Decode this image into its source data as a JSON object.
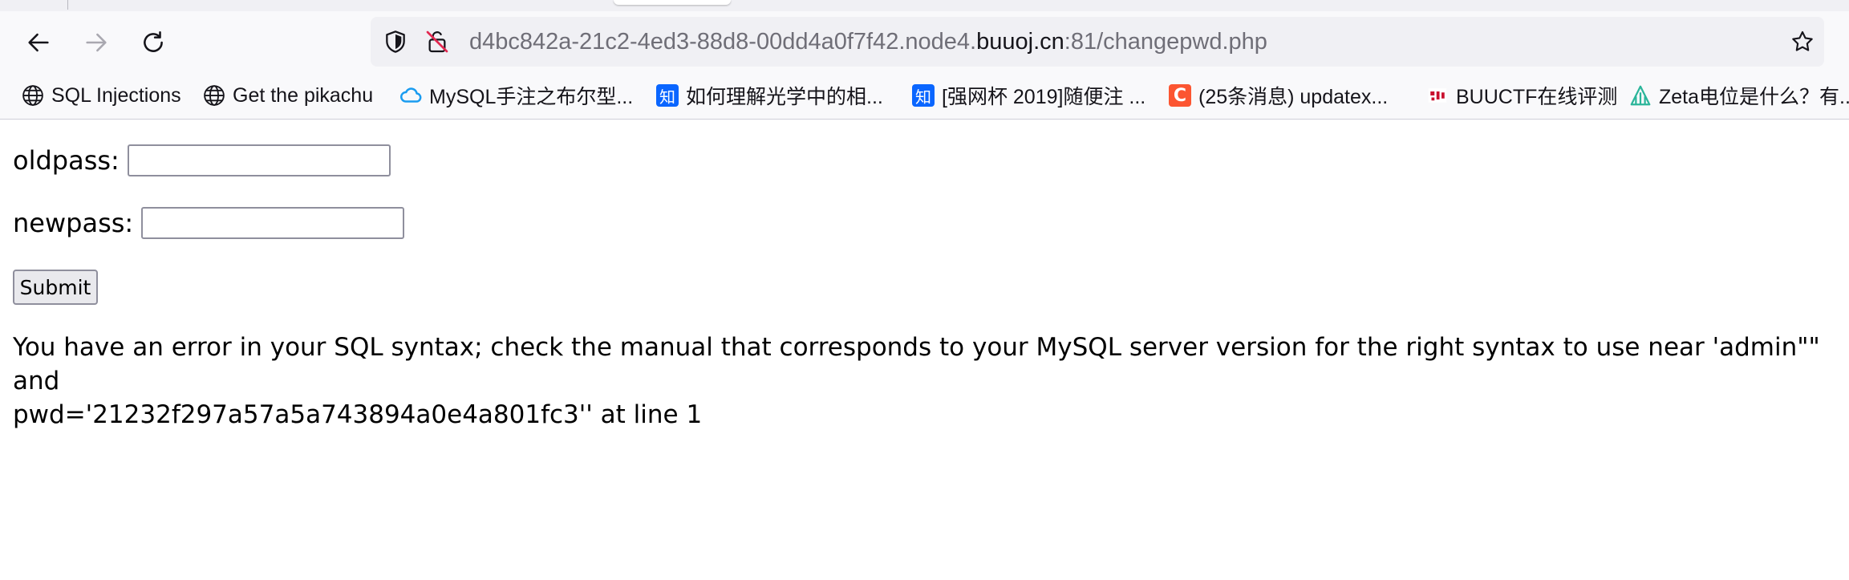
{
  "browser": {
    "url_prefix": "d4bc842a-21c2-4ed3-88d8-00dd4a0f7f42.node4.",
    "url_domain": "buuoj.cn",
    "url_suffix": ":81/changepwd.php",
    "icons": {
      "back": "arrow-left-icon",
      "forward": "arrow-right-icon",
      "reload": "reload-icon",
      "tracking": "shield-icon",
      "connection": "insecure-lock-icon",
      "bookmark": "star-icon"
    }
  },
  "bookmarks": [
    {
      "label": "SQL Injections",
      "icon": "globe-icon"
    },
    {
      "label": "Get the pikachu",
      "icon": "globe-icon"
    },
    {
      "label": "MySQL手注之布尔型...",
      "icon": "cloud-icon"
    },
    {
      "label": "如何理解光学中的相...",
      "icon": "zhihu-icon",
      "icon_text": "知"
    },
    {
      "label": "[强网杯 2019]随便注 ...",
      "icon": "zhihu-icon",
      "icon_text": "知"
    },
    {
      "label": "(25条消息) updatex...",
      "icon": "csdn-icon",
      "icon_text": "C"
    },
    {
      "label": "BUUCTF在线评测",
      "icon": "buuctf-icon"
    },
    {
      "label": "Zeta电位是什么？有...",
      "icon": "zeta-icon"
    }
  ],
  "form": {
    "oldpass_label": "oldpass:",
    "oldpass_value": "",
    "newpass_label": "newpass:",
    "newpass_value": "",
    "submit_label": "Submit"
  },
  "error": {
    "line1": "You have an error in your SQL syntax; check the manual that corresponds to your MySQL server version for the right syntax to use near 'admin\"\" and",
    "line2": "pwd='21232f297a57a5a743894a0e4a801fc3'' at line 1"
  },
  "colors": {
    "accent_zhihu": "#0a66ff",
    "accent_csdn": "#fc5531",
    "cloud": "#1a9cf0"
  }
}
